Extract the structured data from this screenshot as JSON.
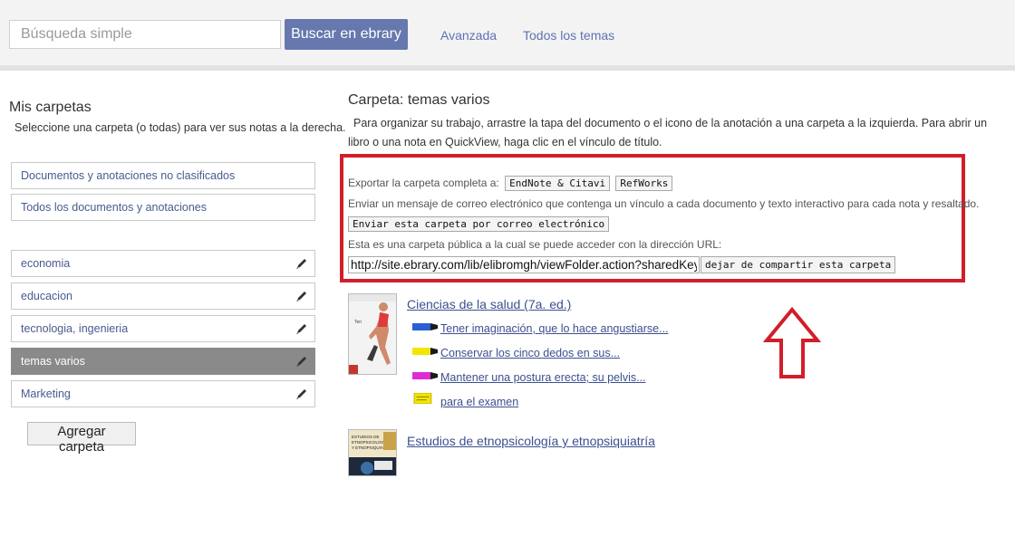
{
  "search": {
    "placeholder": "Búsqueda simple",
    "button_label": "Buscar en ebrary",
    "links": [
      "Avanzada",
      "Todos los temas"
    ]
  },
  "left": {
    "title": "Mis carpetas",
    "description": "Seleccione una carpeta (o todas) para ver sus notas a la derecha.",
    "fixed_folders": [
      "Documentos y anotaciones no clasificados",
      "Todos los documentos y anotaciones"
    ],
    "folders": [
      "economia",
      "educacion",
      "tecnologia, ingenieria",
      "temas varios",
      "Marketing"
    ],
    "selected_folder": "temas varios",
    "add_button": "Agregar carpeta"
  },
  "main": {
    "title": "Carpeta: temas varios",
    "description": "Para organizar su trabajo, arrastre la tapa del documento o el icono de la anotación a una carpeta a la izquierda. Para abrir un libro o una nota en QuickView, haga clic en el vínculo de título.",
    "export_label": "Exportar la carpeta completa a:",
    "export_buttons": [
      "EndNote & Citavi",
      "RefWorks"
    ],
    "email_desc": "Enviar un mensaje de correo electrónico que contenga un vínculo a cada documento y texto interactivo para cada nota y resaltado.",
    "email_button": "Enviar esta carpeta por correo electrónico",
    "public_desc": "Esta es una carpeta pública a la cual se puede acceder con la dirección URL:",
    "url": "http://site.ebrary.com/lib/elibromgh/viewFolder.action?sharedKey=BU",
    "unshare_button": "dejar de compartir esta carpeta"
  },
  "books": [
    {
      "title": "Ciencias de la salud (7a. ed.)",
      "notes": [
        {
          "text": "Tener imaginación, que lo hace angustiarse...",
          "color": "#2a5fd4",
          "icon": "highlight-icon"
        },
        {
          "text": "Conservar los cinco dedos en sus...",
          "color": "#f2e600",
          "icon": "highlight-icon"
        },
        {
          "text": "Mantener una postura erecta; su pelvis...",
          "color": "#e02ad6",
          "icon": "highlight-icon"
        },
        {
          "text": "para el examen",
          "color": "#f2e600",
          "icon": "note-icon"
        }
      ]
    },
    {
      "title": "Estudios de etnopsicología y etnopsiquiatría",
      "notes": []
    }
  ],
  "colors": {
    "search_button": "#6678ad",
    "link": "#5f72b2",
    "selected_folder": "#8a8a8a",
    "highlight_box": "#d21e2a",
    "arrow": "#d21e2a"
  }
}
